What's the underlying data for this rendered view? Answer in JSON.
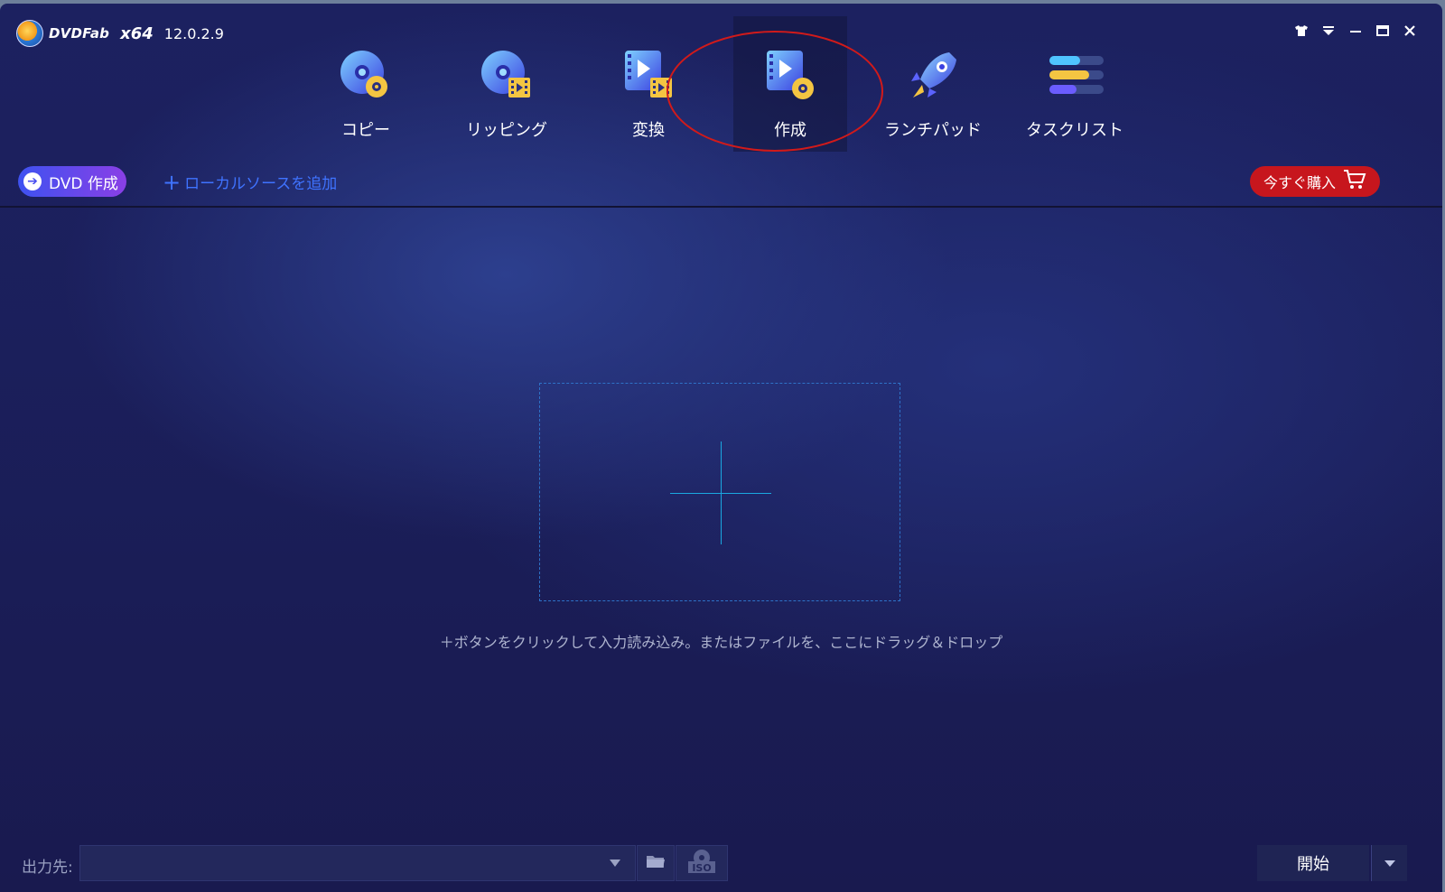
{
  "app": {
    "logo_text": "DVDFab",
    "arch": "x64",
    "version": "12.0.2.9"
  },
  "window_controls": [
    "skin-icon",
    "menu-icon",
    "minimize-icon",
    "maximize-icon",
    "close-icon"
  ],
  "nav": {
    "items": [
      {
        "label": "コピー",
        "icon": "copy-disc-icon"
      },
      {
        "label": "リッピング",
        "icon": "ripper-icon"
      },
      {
        "label": "変換",
        "icon": "converter-icon"
      },
      {
        "label": "作成",
        "icon": "creator-icon",
        "active": true
      },
      {
        "label": "ランチパッド",
        "icon": "launchpad-rocket-icon"
      },
      {
        "label": "タスクリスト",
        "icon": "task-list-icon"
      }
    ]
  },
  "toolbar": {
    "mode_label": "DVD 作成",
    "add_source_label": "ローカルソースを追加",
    "buy_label": "今すぐ購入"
  },
  "dropzone": {
    "hint": "＋ボタンをクリックして入力読み込み。またはファイルを、ここにドラッグ＆ドロップ"
  },
  "bottom": {
    "output_label": "出力先:",
    "output_value": "",
    "iso_label": "ISO",
    "start_label": "開始"
  },
  "colors": {
    "accent_red": "#c7161d",
    "link_blue": "#3f73ff",
    "annotation_red": "#d11a1a"
  }
}
